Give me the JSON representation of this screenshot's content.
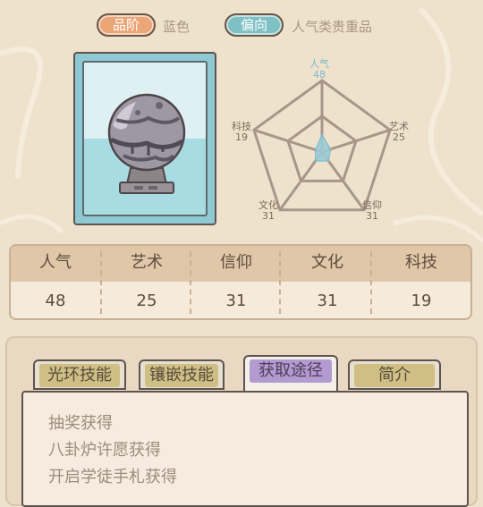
{
  "header": {
    "grade_label": "品阶",
    "grade_value": "蓝色",
    "bias_label": "偏向",
    "bias_value": "人气类贵重品"
  },
  "item": {
    "icon": "stone-orb-on-pedestal"
  },
  "radar": {
    "labels": [
      "人气",
      "艺术",
      "信仰",
      "文化",
      "科技"
    ],
    "values": [
      48,
      25,
      31,
      31,
      19
    ],
    "max": 200,
    "fill_color": "#9ccbd6",
    "highlight_color": "#7fbfd0"
  },
  "stats": {
    "headers": [
      "人气",
      "艺术",
      "信仰",
      "文化",
      "科技"
    ],
    "values": [
      "48",
      "25",
      "31",
      "31",
      "19"
    ]
  },
  "tabs": [
    {
      "label": "光环技能",
      "active": false
    },
    {
      "label": "镶嵌技能",
      "active": false
    },
    {
      "label": "获取途径",
      "active": true
    },
    {
      "label": "简介",
      "active": false
    }
  ],
  "content": {
    "lines": [
      "抽奖获得",
      "八卦炉许愿获得",
      "开启学徒手札获得"
    ]
  },
  "colors": {
    "grade_badge": "#eba577",
    "bias_badge": "#7fc0c4",
    "active_tab": "#b39bd2",
    "inactive_tab": "#cfbf84"
  }
}
